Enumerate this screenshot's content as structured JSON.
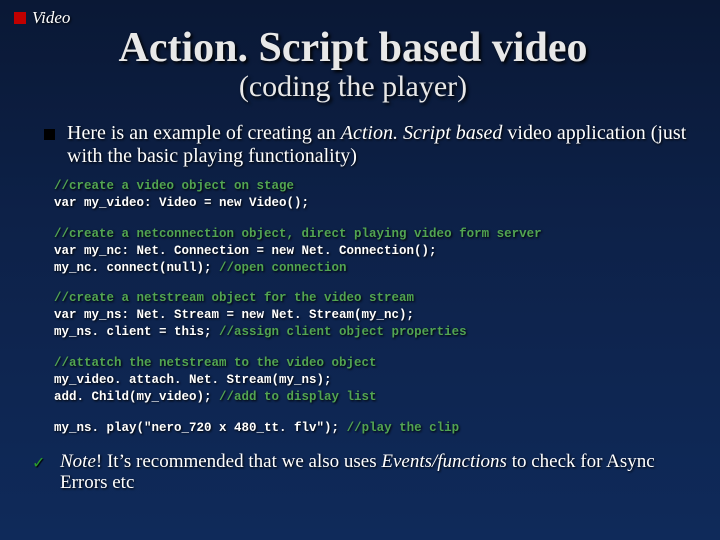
{
  "breadcrumb": {
    "label": "Video"
  },
  "heading": {
    "title": "Action. Script based video",
    "subtitle": "(coding the player)"
  },
  "intro": {
    "pre": "Here is an example of creating an ",
    "em": "Action. Script based",
    "post": " video application (just with the basic playing functionality)"
  },
  "code": {
    "b1_c": "//create a video object on stage",
    "b1_l": "var my_video: Video = new Video();",
    "b2_c": "//create a netconnection object, direct playing video form server",
    "b2_l1": "var my_nc: Net. Connection = new Net. Connection();",
    "b2_l2a": "my_nc. connect(null); ",
    "b2_l2b": "//open connection",
    "b3_c": "//create a netstream object for the video stream",
    "b3_l1": "var my_ns: Net. Stream = new Net. Stream(my_nc);",
    "b3_l2a": "my_ns. client = this; ",
    "b3_l2b": "//assign client object properties",
    "b4_c": "//attatch the netstream to the video object",
    "b4_l1": "my_video. attach. Net. Stream(my_ns);",
    "b4_l2a": "add. Child(my_video); ",
    "b4_l2b": "//add to display list",
    "b5_l1a": "my_ns. play(\"nero_720 x 480_tt. flv\"); ",
    "b5_l1b": "//play the clip"
  },
  "note": {
    "lead": "Note",
    "mid": "! It’s recommended that we also uses ",
    "em": "Events/functions",
    "tail": " to check for Async Errors etc"
  }
}
